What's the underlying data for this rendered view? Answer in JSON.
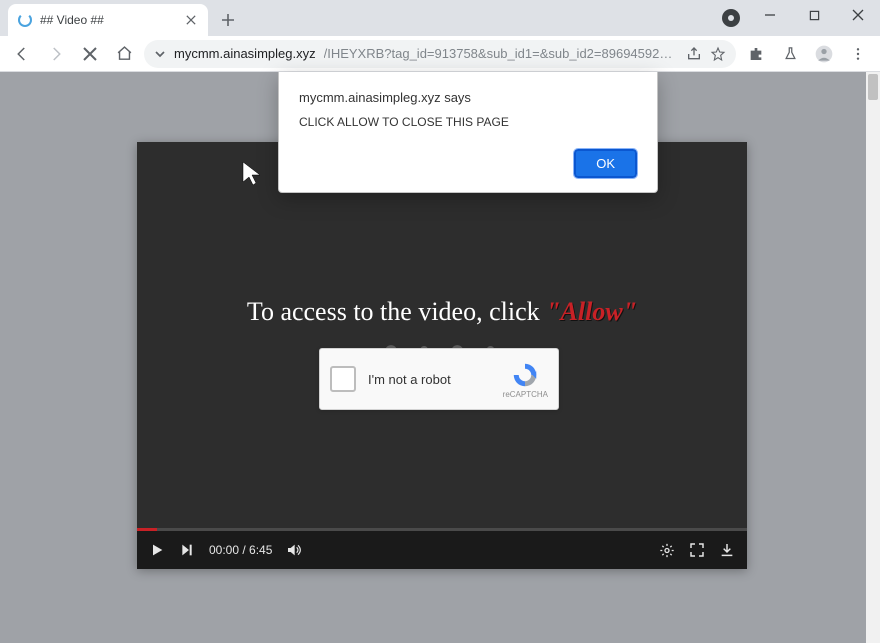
{
  "titlebar": {
    "tab_title": "## Video ##"
  },
  "toolbar": {
    "url_host": "mycmm.ainasimpleg.xyz",
    "url_rest": "/IHEYXRB?tag_id=913758&sub_id1=&sub_id2=8969459296618908242&cookie..."
  },
  "alert": {
    "title_host": "mycmm.ainasimpleg.xyz says",
    "body": "CLICK ALLOW TO CLOSE THIS PAGE",
    "ok_label": "OK"
  },
  "player": {
    "message_prefix": "To access to the video, click ",
    "message_allow": "\"Allow\"",
    "time_current": "00:00",
    "time_sep": " / ",
    "time_total": "6:45"
  },
  "captcha": {
    "label": "I'm not a robot",
    "brand": "reCAPTCHA"
  }
}
